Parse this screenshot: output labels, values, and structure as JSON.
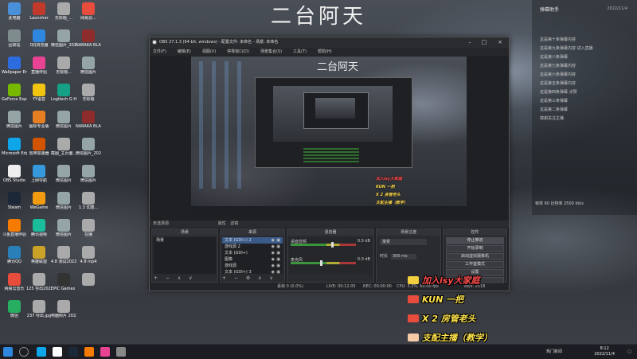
{
  "wallpaper": {
    "title": "二台阿天"
  },
  "desktop_icons": [
    {
      "label": "此电脑",
      "color": "#4a90d9"
    },
    {
      "label": "Launcher",
      "color": "#c0392b"
    },
    {
      "label": "无标题_...",
      "color": "#aaa"
    },
    {
      "label": "网易云...",
      "color": "#e74c3c"
    },
    {
      "label": "回收站",
      "color": "#7f8c8d"
    },
    {
      "label": "QQ浏览器",
      "color": "#2e86de"
    },
    {
      "label": "微信图片_2022...",
      "color": "#95a5a6"
    },
    {
      "label": "NARAKA BLADEPOI...",
      "color": "#8e2b2b"
    },
    {
      "label": "Wallpaper Engine",
      "color": "#2d6cdf"
    },
    {
      "label": "直播伴侣",
      "color": "#e84393"
    },
    {
      "label": "无标题...",
      "color": "#aaa"
    },
    {
      "label": "微信图片",
      "color": "#95a5a6"
    },
    {
      "label": "GeForce Experience",
      "color": "#76b900"
    },
    {
      "label": "YY语音",
      "color": "#f1c40f"
    },
    {
      "label": "Logitech G HUB",
      "color": "#16a085"
    },
    {
      "label": "无标题",
      "color": "#aaa"
    },
    {
      "label": "微信图片",
      "color": "#95a5a6"
    },
    {
      "label": "图标专业版",
      "color": "#e67e22"
    },
    {
      "label": "微信图片",
      "color": "#95a5a6"
    },
    {
      "label": "NARAKA BLADEPOI...",
      "color": "#8e2b2b"
    },
    {
      "label": "Microsoft Edge",
      "color": "#0ea5e9"
    },
    {
      "label": "雷神加速器",
      "color": "#d35400"
    },
    {
      "label": "截图_主页面...",
      "color": "#aaa"
    },
    {
      "label": "微信图片_2022...",
      "color": "#95a5a6"
    },
    {
      "label": "OBS Studio",
      "color": "#eeeeee"
    },
    {
      "label": "上网导航",
      "color": "#3498db"
    },
    {
      "label": "微信图片",
      "color": "#95a5a6"
    },
    {
      "label": "微信图片",
      "color": "#95a5a6"
    },
    {
      "label": "Steam",
      "color": "#1b2838"
    },
    {
      "label": "WeGame",
      "color": "#f39c12"
    },
    {
      "label": "微信图片",
      "color": "#95a5a6"
    },
    {
      "label": "1.3 优酷...",
      "color": "#aaa"
    },
    {
      "label": "斗鱼直播伴侣",
      "color": "#f57c00"
    },
    {
      "label": "腾讯视频",
      "color": "#1abc9c"
    },
    {
      "label": "微信图片",
      "color": "#95a5a6"
    },
    {
      "label": "在播",
      "color": "#aaa"
    },
    {
      "label": "腾讯QQ",
      "color": "#2980b9"
    },
    {
      "label": "英雄联盟",
      "color": "#c9a227"
    },
    {
      "label": "4.8 测试2022...",
      "color": "#aaa"
    },
    {
      "label": "4.8 mp4",
      "color": "#aaa"
    },
    {
      "label": "网易云音乐",
      "color": "#e74c3c"
    },
    {
      "label": "125 导出2022...",
      "color": "#aaa"
    },
    {
      "label": "EPIC Games Launcher",
      "color": "#333"
    },
    {
      "label": "",
      "color": "#aaa"
    },
    {
      "label": "微信",
      "color": "#27ae60"
    },
    {
      "label": "237 导出.jpg",
      "color": "#aaa"
    },
    {
      "label": "电脑照片 2022...",
      "color": "#aaa"
    }
  ],
  "widget": {
    "title": "弹幕助手",
    "date": "2022/11/4",
    "lines": [
      "这是第十条弹幕内容",
      "这是第九条弹幕内容 进入直播",
      "这是第八条弹幕",
      "这是第七条弹幕内容",
      "这是第六条弹幕内容",
      "这是第五条弹幕内容",
      "这是第四条弹幕 点赞",
      "这是第三条弹幕",
      "这是第二条弹幕",
      "感谢关注主播"
    ],
    "status": "帧率 60 比特率 2500 kb/s"
  },
  "obs": {
    "title": "OBS 27.1.3 (64-bit, windows) - 配置文件: 未命名 - 场景: 未命名",
    "menu": [
      "文件(F)",
      "编辑(E)",
      "视图(V)",
      "停靠窗口(D)",
      "场景集合(S)",
      "工具(T)",
      "帮助(H)"
    ],
    "preview": {
      "title": "二台阿天",
      "mini": [
        "加入isy大家庭",
        "KUN 一把",
        "X 2 房管老头",
        "支配主播（教学）"
      ]
    },
    "tabs": [
      "未选择源",
      "属性",
      "滤镜"
    ],
    "docks": {
      "scenes": {
        "header": "场景",
        "items": [
          "场景"
        ],
        "footer": "+ − ∧ ∨"
      },
      "sources": {
        "header": "来源",
        "items": [
          "文本 (GDI+) 2",
          "游戏源 2",
          "文本 (GDI+)",
          "图像",
          "游戏源",
          "文本 (GDI+) 3"
        ],
        "footer": "+ − ⚙ ∧ ∨"
      },
      "mixer": {
        "header": "混音器",
        "tracks": [
          {
            "name": "桌面音频",
            "db": "0.0 dB",
            "level": 0.62
          },
          {
            "name": "麦克风",
            "db": "0.0 dB",
            "level": 0.45
          }
        ]
      },
      "transitions": {
        "header": "场景过渡",
        "selected": "渐变",
        "duration_label": "时长",
        "duration": "300 ms"
      },
      "controls": {
        "header": "控件",
        "buttons": [
          "停止推流",
          "开始录制",
          "启动虚拟摄像机",
          "工作室模式",
          "设置",
          "退出"
        ]
      }
    },
    "status": {
      "dropped": "丢帧 0 (0.0%)",
      "live": "LIVE: 00:12:05",
      "rec": "REC: 00:00:00",
      "cpu": "CPU: 3.2%, 60.00 fps",
      "kbps": "kb/s: 2518"
    }
  },
  "overlay_lines": [
    {
      "text": "加入isy大家庭",
      "color": "#ff4d4d",
      "icon": "#f4d03f"
    },
    {
      "text": "KUN 一把",
      "color": "#ffe34d",
      "icon": "#e74c3c"
    },
    {
      "text": "X 2 房管老头",
      "color": "#ffe34d",
      "icon": "#e74c3c"
    },
    {
      "text": "支配主播（教学）",
      "color": "#ffe34d",
      "icon": "#f5cba7"
    }
  ],
  "taskbar": {
    "apps": [
      "#0ea5e9",
      "#ffffff",
      "#1b2838",
      "#f57c00",
      "#e84393",
      "#888888"
    ],
    "tray": "热门新闻",
    "time": "8:12",
    "date": "2022/11/4"
  }
}
